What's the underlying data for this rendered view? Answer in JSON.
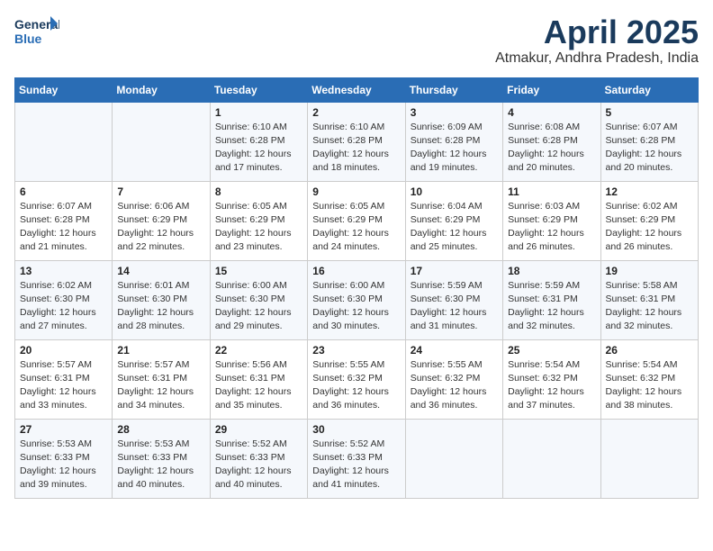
{
  "logo": {
    "line1": "General",
    "line2": "Blue"
  },
  "title": "April 2025",
  "location": "Atmakur, Andhra Pradesh, India",
  "days_of_week": [
    "Sunday",
    "Monday",
    "Tuesday",
    "Wednesday",
    "Thursday",
    "Friday",
    "Saturday"
  ],
  "weeks": [
    [
      {
        "day": "",
        "info": ""
      },
      {
        "day": "",
        "info": ""
      },
      {
        "day": "1",
        "info": "Sunrise: 6:10 AM\nSunset: 6:28 PM\nDaylight: 12 hours and 17 minutes."
      },
      {
        "day": "2",
        "info": "Sunrise: 6:10 AM\nSunset: 6:28 PM\nDaylight: 12 hours and 18 minutes."
      },
      {
        "day": "3",
        "info": "Sunrise: 6:09 AM\nSunset: 6:28 PM\nDaylight: 12 hours and 19 minutes."
      },
      {
        "day": "4",
        "info": "Sunrise: 6:08 AM\nSunset: 6:28 PM\nDaylight: 12 hours and 20 minutes."
      },
      {
        "day": "5",
        "info": "Sunrise: 6:07 AM\nSunset: 6:28 PM\nDaylight: 12 hours and 20 minutes."
      }
    ],
    [
      {
        "day": "6",
        "info": "Sunrise: 6:07 AM\nSunset: 6:28 PM\nDaylight: 12 hours and 21 minutes."
      },
      {
        "day": "7",
        "info": "Sunrise: 6:06 AM\nSunset: 6:29 PM\nDaylight: 12 hours and 22 minutes."
      },
      {
        "day": "8",
        "info": "Sunrise: 6:05 AM\nSunset: 6:29 PM\nDaylight: 12 hours and 23 minutes."
      },
      {
        "day": "9",
        "info": "Sunrise: 6:05 AM\nSunset: 6:29 PM\nDaylight: 12 hours and 24 minutes."
      },
      {
        "day": "10",
        "info": "Sunrise: 6:04 AM\nSunset: 6:29 PM\nDaylight: 12 hours and 25 minutes."
      },
      {
        "day": "11",
        "info": "Sunrise: 6:03 AM\nSunset: 6:29 PM\nDaylight: 12 hours and 26 minutes."
      },
      {
        "day": "12",
        "info": "Sunrise: 6:02 AM\nSunset: 6:29 PM\nDaylight: 12 hours and 26 minutes."
      }
    ],
    [
      {
        "day": "13",
        "info": "Sunrise: 6:02 AM\nSunset: 6:30 PM\nDaylight: 12 hours and 27 minutes."
      },
      {
        "day": "14",
        "info": "Sunrise: 6:01 AM\nSunset: 6:30 PM\nDaylight: 12 hours and 28 minutes."
      },
      {
        "day": "15",
        "info": "Sunrise: 6:00 AM\nSunset: 6:30 PM\nDaylight: 12 hours and 29 minutes."
      },
      {
        "day": "16",
        "info": "Sunrise: 6:00 AM\nSunset: 6:30 PM\nDaylight: 12 hours and 30 minutes."
      },
      {
        "day": "17",
        "info": "Sunrise: 5:59 AM\nSunset: 6:30 PM\nDaylight: 12 hours and 31 minutes."
      },
      {
        "day": "18",
        "info": "Sunrise: 5:59 AM\nSunset: 6:31 PM\nDaylight: 12 hours and 32 minutes."
      },
      {
        "day": "19",
        "info": "Sunrise: 5:58 AM\nSunset: 6:31 PM\nDaylight: 12 hours and 32 minutes."
      }
    ],
    [
      {
        "day": "20",
        "info": "Sunrise: 5:57 AM\nSunset: 6:31 PM\nDaylight: 12 hours and 33 minutes."
      },
      {
        "day": "21",
        "info": "Sunrise: 5:57 AM\nSunset: 6:31 PM\nDaylight: 12 hours and 34 minutes."
      },
      {
        "day": "22",
        "info": "Sunrise: 5:56 AM\nSunset: 6:31 PM\nDaylight: 12 hours and 35 minutes."
      },
      {
        "day": "23",
        "info": "Sunrise: 5:55 AM\nSunset: 6:32 PM\nDaylight: 12 hours and 36 minutes."
      },
      {
        "day": "24",
        "info": "Sunrise: 5:55 AM\nSunset: 6:32 PM\nDaylight: 12 hours and 36 minutes."
      },
      {
        "day": "25",
        "info": "Sunrise: 5:54 AM\nSunset: 6:32 PM\nDaylight: 12 hours and 37 minutes."
      },
      {
        "day": "26",
        "info": "Sunrise: 5:54 AM\nSunset: 6:32 PM\nDaylight: 12 hours and 38 minutes."
      }
    ],
    [
      {
        "day": "27",
        "info": "Sunrise: 5:53 AM\nSunset: 6:33 PM\nDaylight: 12 hours and 39 minutes."
      },
      {
        "day": "28",
        "info": "Sunrise: 5:53 AM\nSunset: 6:33 PM\nDaylight: 12 hours and 40 minutes."
      },
      {
        "day": "29",
        "info": "Sunrise: 5:52 AM\nSunset: 6:33 PM\nDaylight: 12 hours and 40 minutes."
      },
      {
        "day": "30",
        "info": "Sunrise: 5:52 AM\nSunset: 6:33 PM\nDaylight: 12 hours and 41 minutes."
      },
      {
        "day": "",
        "info": ""
      },
      {
        "day": "",
        "info": ""
      },
      {
        "day": "",
        "info": ""
      }
    ]
  ]
}
